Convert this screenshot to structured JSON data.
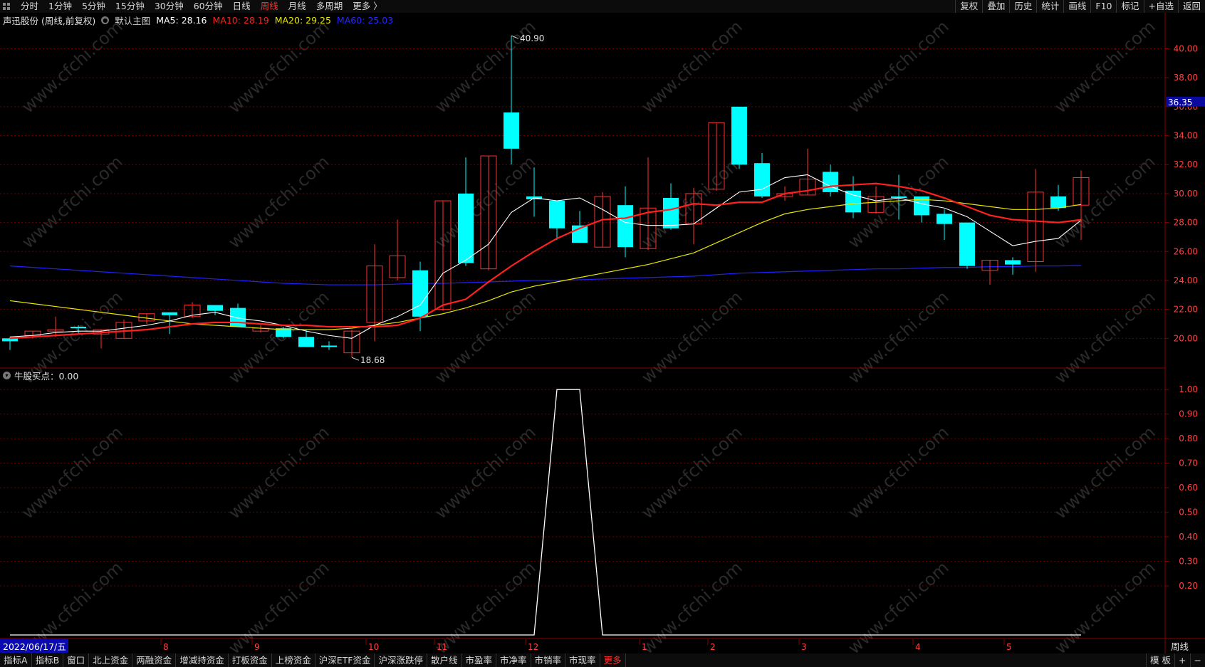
{
  "topbar": {
    "periods": [
      "分时",
      "1分钟",
      "5分钟",
      "15分钟",
      "30分钟",
      "60分钟",
      "日线",
      "周线",
      "月线",
      "多周期",
      "更多 〉"
    ],
    "active_period": "周线",
    "tools": [
      "复权",
      "叠加",
      "历史",
      "统计",
      "画线",
      "F10",
      "标记",
      "+自选",
      "返回"
    ]
  },
  "info": {
    "title": "声迅股份 (周线,前复权)",
    "main_label": "默认主图",
    "ma5": "MA5: 28.16",
    "ma10": "MA10: 28.19",
    "ma20": "MA20: 29.25",
    "ma60": "MA60: 25.03"
  },
  "indicator": {
    "label": "牛股买点：0.00"
  },
  "date_label": "2022/06/17/五",
  "period_label": "周线",
  "price_tag": "36.35",
  "watermark": "www.cfchi.com",
  "colors": {
    "up": "#ff3030",
    "down": "#00ffff",
    "ma5": "#ffffff",
    "ma10": "#ff2020",
    "ma20": "#e8e800",
    "ma60": "#2020ff",
    "grid": "#6a0000"
  },
  "bottom_tabs": [
    "指标A",
    "指标B",
    "窗口",
    "北上资金",
    "两融资金",
    "增减持资金",
    "打板资金",
    "上榜资金",
    "沪深ETF资金",
    "沪深涨跌停",
    "散户线",
    "市盈率",
    "市净率",
    "市销率",
    "市现率",
    "更多"
  ],
  "bottom_highlight": "更多",
  "bottom_corner": [
    "模 板",
    "+",
    "−"
  ],
  "chart_data": [
    {
      "type": "candlestick",
      "title": "声迅股份 (周线,前复权)",
      "ylim": [
        18,
        41.5
      ],
      "yticks": [
        20,
        22,
        24,
        26,
        28,
        30,
        32,
        34,
        36,
        38,
        40
      ],
      "x_month_labels": [
        {
          "index": 7,
          "label": "8"
        },
        {
          "index": 11,
          "label": "9"
        },
        {
          "index": 16,
          "label": "10"
        },
        {
          "index": 19,
          "label": "11"
        },
        {
          "index": 23,
          "label": "12"
        },
        {
          "index": 28,
          "label": "1"
        },
        {
          "index": 31,
          "label": "2"
        },
        {
          "index": 35,
          "label": "3"
        },
        {
          "index": 40,
          "label": "4"
        },
        {
          "index": 44,
          "label": "5"
        }
      ],
      "candles": [
        [
          20.0,
          19.8,
          20.1,
          19.2
        ],
        [
          20.2,
          20.5,
          20.5,
          20.0
        ],
        [
          20.5,
          20.6,
          21.5,
          20.1
        ],
        [
          20.8,
          20.7,
          20.9,
          20.3
        ],
        [
          20.3,
          20.6,
          20.6,
          19.3
        ],
        [
          20.0,
          21.1,
          21.3,
          20.0
        ],
        [
          21.2,
          21.7,
          21.7,
          21.0
        ],
        [
          21.8,
          21.6,
          21.8,
          20.3
        ],
        [
          21.5,
          22.3,
          22.5,
          21.4
        ],
        [
          22.3,
          21.9,
          22.3,
          21.6
        ],
        [
          22.1,
          20.8,
          22.4,
          20.8
        ],
        [
          20.5,
          20.7,
          20.9,
          20.4
        ],
        [
          20.7,
          20.1,
          20.8,
          20.0
        ],
        [
          20.1,
          19.4,
          20.6,
          19.4
        ],
        [
          19.5,
          19.4,
          19.8,
          19.2
        ],
        [
          19.0,
          20.5,
          20.6,
          18.68
        ],
        [
          21.1,
          25.0,
          26.5,
          19.8
        ],
        [
          24.2,
          25.7,
          28.2,
          24.0
        ],
        [
          24.7,
          21.5,
          25.3,
          20.5
        ],
        [
          22.0,
          29.5,
          29.5,
          21.9
        ],
        [
          30.0,
          25.2,
          32.5,
          25.0
        ],
        [
          24.8,
          32.6,
          32.6,
          24.7
        ],
        [
          35.6,
          33.1,
          40.9,
          32.0
        ],
        [
          29.8,
          29.6,
          31.8,
          28.4
        ],
        [
          29.5,
          27.6,
          29.5,
          26.8
        ],
        [
          27.8,
          26.6,
          28.8,
          26.6
        ],
        [
          26.3,
          29.8,
          30.1,
          26.3
        ],
        [
          29.2,
          26.3,
          30.5,
          25.6
        ],
        [
          26.2,
          29.0,
          32.5,
          26.1
        ],
        [
          29.7,
          27.6,
          30.7,
          27.5
        ],
        [
          27.9,
          30.0,
          30.4,
          26.5
        ],
        [
          30.3,
          34.9,
          34.9,
          30.2
        ],
        [
          36.0,
          32.0,
          36.0,
          31.7
        ],
        [
          32.1,
          29.8,
          32.8,
          29.7
        ],
        [
          29.8,
          30.0,
          30.5,
          29.5
        ],
        [
          29.9,
          31.0,
          33.1,
          29.9
        ],
        [
          31.5,
          30.1,
          32.0,
          29.8
        ],
        [
          30.2,
          28.7,
          31.2,
          28.3
        ],
        [
          28.7,
          29.8,
          30.5,
          28.6
        ],
        [
          29.8,
          29.7,
          31.3,
          28.2
        ],
        [
          29.8,
          28.5,
          29.8,
          28.0
        ],
        [
          28.6,
          27.9,
          28.9,
          26.8
        ],
        [
          28.0,
          25.0,
          28.0,
          24.8
        ],
        [
          24.7,
          25.4,
          25.4,
          23.7
        ],
        [
          25.4,
          25.1,
          25.6,
          24.4
        ],
        [
          25.3,
          30.1,
          31.7,
          24.6
        ],
        [
          29.8,
          29.0,
          30.6,
          28.8
        ],
        [
          29.2,
          31.1,
          31.6,
          26.8
        ]
      ],
      "ma5": [
        20.1,
        20.2,
        20.4,
        20.5,
        20.5,
        20.7,
        20.9,
        21.2,
        21.6,
        21.8,
        21.4,
        21.2,
        20.9,
        20.5,
        20.2,
        20.0,
        20.9,
        21.5,
        22.3,
        24.5,
        25.4,
        26.5,
        28.7,
        29.7,
        29.5,
        29.7,
        28.9,
        28.0,
        27.8,
        27.8,
        27.9,
        29.0,
        30.1,
        30.3,
        31.1,
        31.3,
        30.5,
        29.9,
        29.5,
        29.7,
        29.3,
        29.0,
        28.4,
        27.4,
        26.4,
        26.7,
        26.9,
        28.16
      ],
      "ma10": [
        20.0,
        20.1,
        20.2,
        20.3,
        20.4,
        20.5,
        20.6,
        20.8,
        21.0,
        21.1,
        21.1,
        21.0,
        20.9,
        20.9,
        20.8,
        20.8,
        20.8,
        20.9,
        21.4,
        22.3,
        22.7,
        23.9,
        25.0,
        26.0,
        26.9,
        27.6,
        28.2,
        28.3,
        28.7,
        28.9,
        29.3,
        29.2,
        29.4,
        29.4,
        30.0,
        30.2,
        30.5,
        30.6,
        30.7,
        30.5,
        30.2,
        29.7,
        29.1,
        28.5,
        28.2,
        28.1,
        28.0,
        28.19
      ],
      "ma20": [
        22.6,
        22.4,
        22.2,
        22.0,
        21.8,
        21.6,
        21.4,
        21.2,
        21.0,
        20.9,
        20.8,
        20.7,
        20.6,
        20.6,
        20.6,
        20.7,
        20.9,
        21.1,
        21.4,
        21.7,
        22.1,
        22.6,
        23.2,
        23.6,
        23.9,
        24.2,
        24.5,
        24.8,
        25.1,
        25.5,
        25.9,
        26.6,
        27.3,
        28.0,
        28.6,
        28.9,
        29.1,
        29.3,
        29.4,
        29.5,
        29.6,
        29.5,
        29.3,
        29.1,
        28.9,
        28.9,
        29.0,
        29.25
      ],
      "ma60": [
        25.0,
        24.9,
        24.8,
        24.7,
        24.6,
        24.5,
        24.4,
        24.3,
        24.2,
        24.1,
        24.0,
        23.9,
        23.8,
        23.75,
        23.7,
        23.7,
        23.7,
        23.75,
        23.8,
        23.8,
        23.85,
        23.9,
        23.95,
        24.0,
        24.0,
        24.05,
        24.1,
        24.15,
        24.2,
        24.25,
        24.3,
        24.4,
        24.5,
        24.55,
        24.6,
        24.65,
        24.7,
        24.75,
        24.8,
        24.8,
        24.85,
        24.9,
        24.9,
        24.95,
        24.95,
        25.0,
        25.0,
        25.03
      ],
      "annotations": [
        {
          "index": 22,
          "value": 40.9,
          "label": "40.90"
        },
        {
          "index": 15,
          "value": 18.68,
          "label": "18.68"
        }
      ]
    },
    {
      "type": "line",
      "title": "牛股买点",
      "ylim": [
        0,
        1.05
      ],
      "yticks": [
        0.2,
        0.3,
        0.4,
        0.5,
        0.6,
        0.7,
        0.8,
        0.9,
        1.0
      ],
      "values": [
        0,
        0,
        0,
        0,
        0,
        0,
        0,
        0,
        0,
        0,
        0,
        0,
        0,
        0,
        0,
        0,
        0,
        0,
        0,
        0,
        0,
        0,
        0,
        0,
        1,
        1,
        0,
        0,
        0,
        0,
        0,
        0,
        0,
        0,
        0,
        0,
        0,
        0,
        0,
        0,
        0,
        0,
        0,
        0,
        0,
        0,
        0,
        0
      ]
    }
  ]
}
